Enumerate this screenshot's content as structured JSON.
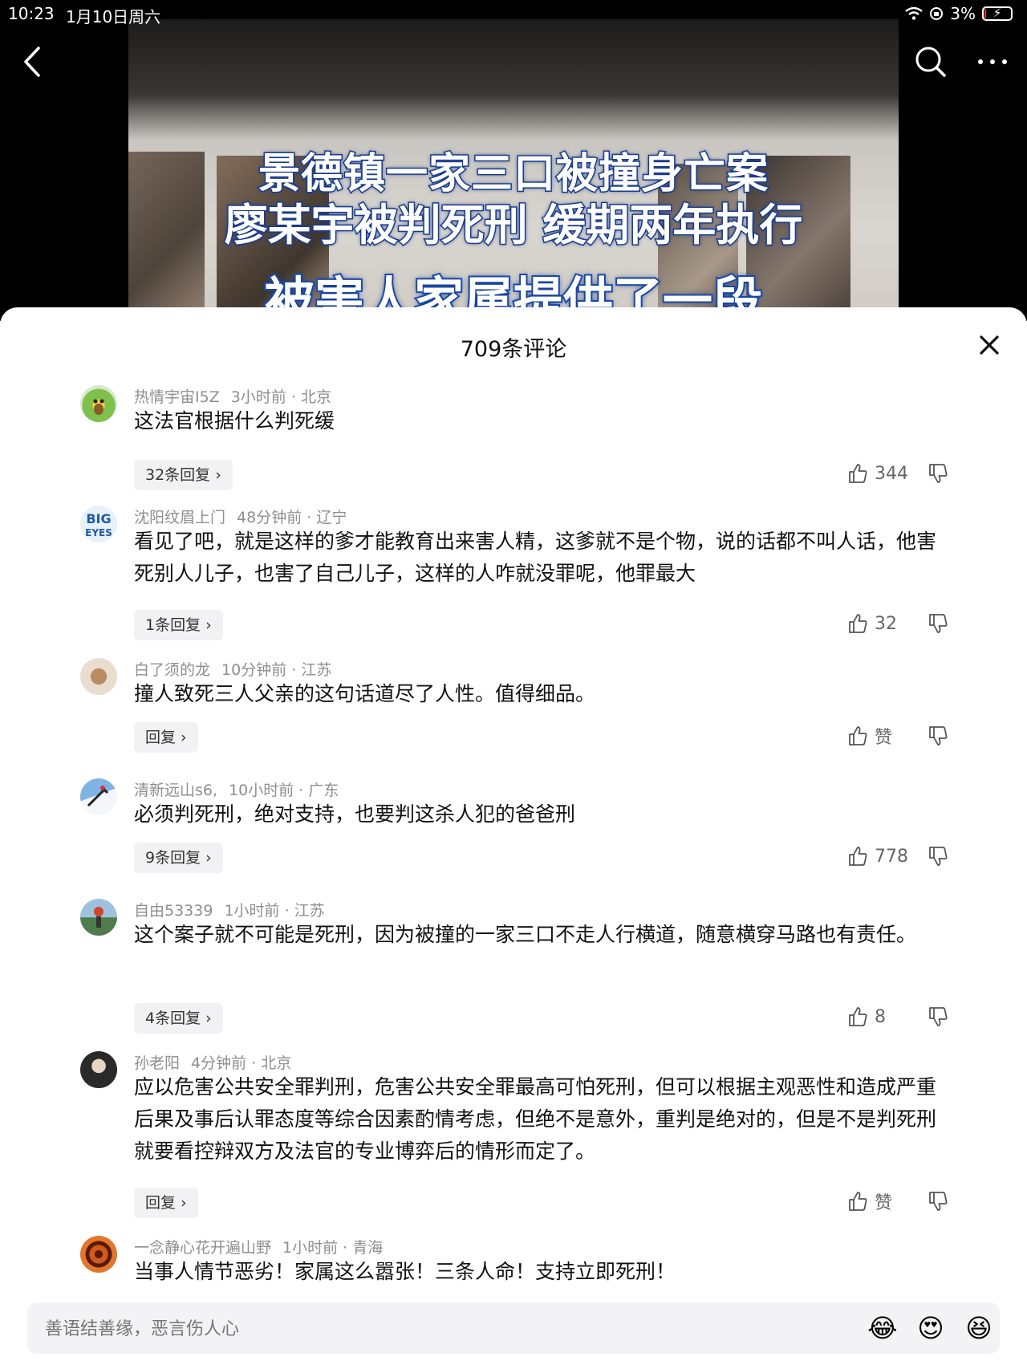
{
  "status_bar": {
    "time": "10:23",
    "date": "1月10日周六",
    "battery_pct": "3%",
    "battery_level": 0.03
  },
  "video": {
    "caption_line1": "景德镇一家三口被撞身亡案",
    "caption_line2": "廖某宇被判死刑 缓期两年执行",
    "caption_line3": "被害人家属提供了一段"
  },
  "comments_sheet": {
    "title": "709条评论",
    "comments": [
      {
        "username": "热情宇宙I5Z",
        "time": "3小时前",
        "location": "北京",
        "text": "这法官根据什么判死缓",
        "reply": "32条回复",
        "likes": "344"
      },
      {
        "username": "沈阳纹眉上门",
        "time": "48分钟前",
        "location": "辽宁",
        "text": "看见了吧，就是这样的爹才能教育出来害人精，这爹就不是个物，说的话都不叫人话，他害死别人儿子，也害了自己儿子，这样的人咋就没罪呢，他罪最大",
        "reply": "1条回复",
        "likes": "32"
      },
      {
        "username": "白了须的龙",
        "time": "10分钟前",
        "location": "江苏",
        "text": "撞人致死三人父亲的这句话道尽了人性。值得细品。",
        "reply": "回复",
        "likes": "赞"
      },
      {
        "username": "清新远山s6,",
        "time": "10小时前",
        "location": "广东",
        "text": "必须判死刑，绝对支持，也要判这杀人犯的爸爸刑",
        "reply": "9条回复",
        "likes": "778"
      },
      {
        "username": "自由53339",
        "time": "1小时前",
        "location": "江苏",
        "text": "这个案子就不可能是死刑，因为被撞的一家三口不走人行横道，随意横穿马路也有责任。",
        "reply": "4条回复",
        "likes": "8"
      },
      {
        "username": "孙老阳",
        "time": "4分钟前",
        "location": "北京",
        "text": "应以危害公共安全罪判刑，危害公共安全罪最高可怕死刑，但可以根据主观恶性和造成严重后果及事后认罪态度等综合因素酌情考虑，但绝不是意外，重判是绝对的，但是不是判死刑就要看控辩双方及法官的专业博弈后的情形而定了。",
        "reply": "回复",
        "likes": "赞"
      },
      {
        "username": "一念静心花开遍山野",
        "time": "1小时前",
        "location": "青海",
        "text": "当事人情节恶劣！家属这么嚣张！三条人命！支持立即死刑！"
      }
    ]
  },
  "input_bar": {
    "placeholder": "善语结善缘，恶言伤人心",
    "emojis": [
      "😂",
      "😍",
      "😆"
    ]
  },
  "icons": {
    "back": "chevron-left-icon",
    "search": "search-icon",
    "more": "more-dots-icon",
    "close": "close-icon",
    "like": "thumbs-up-icon",
    "dislike": "thumbs-down-icon"
  }
}
